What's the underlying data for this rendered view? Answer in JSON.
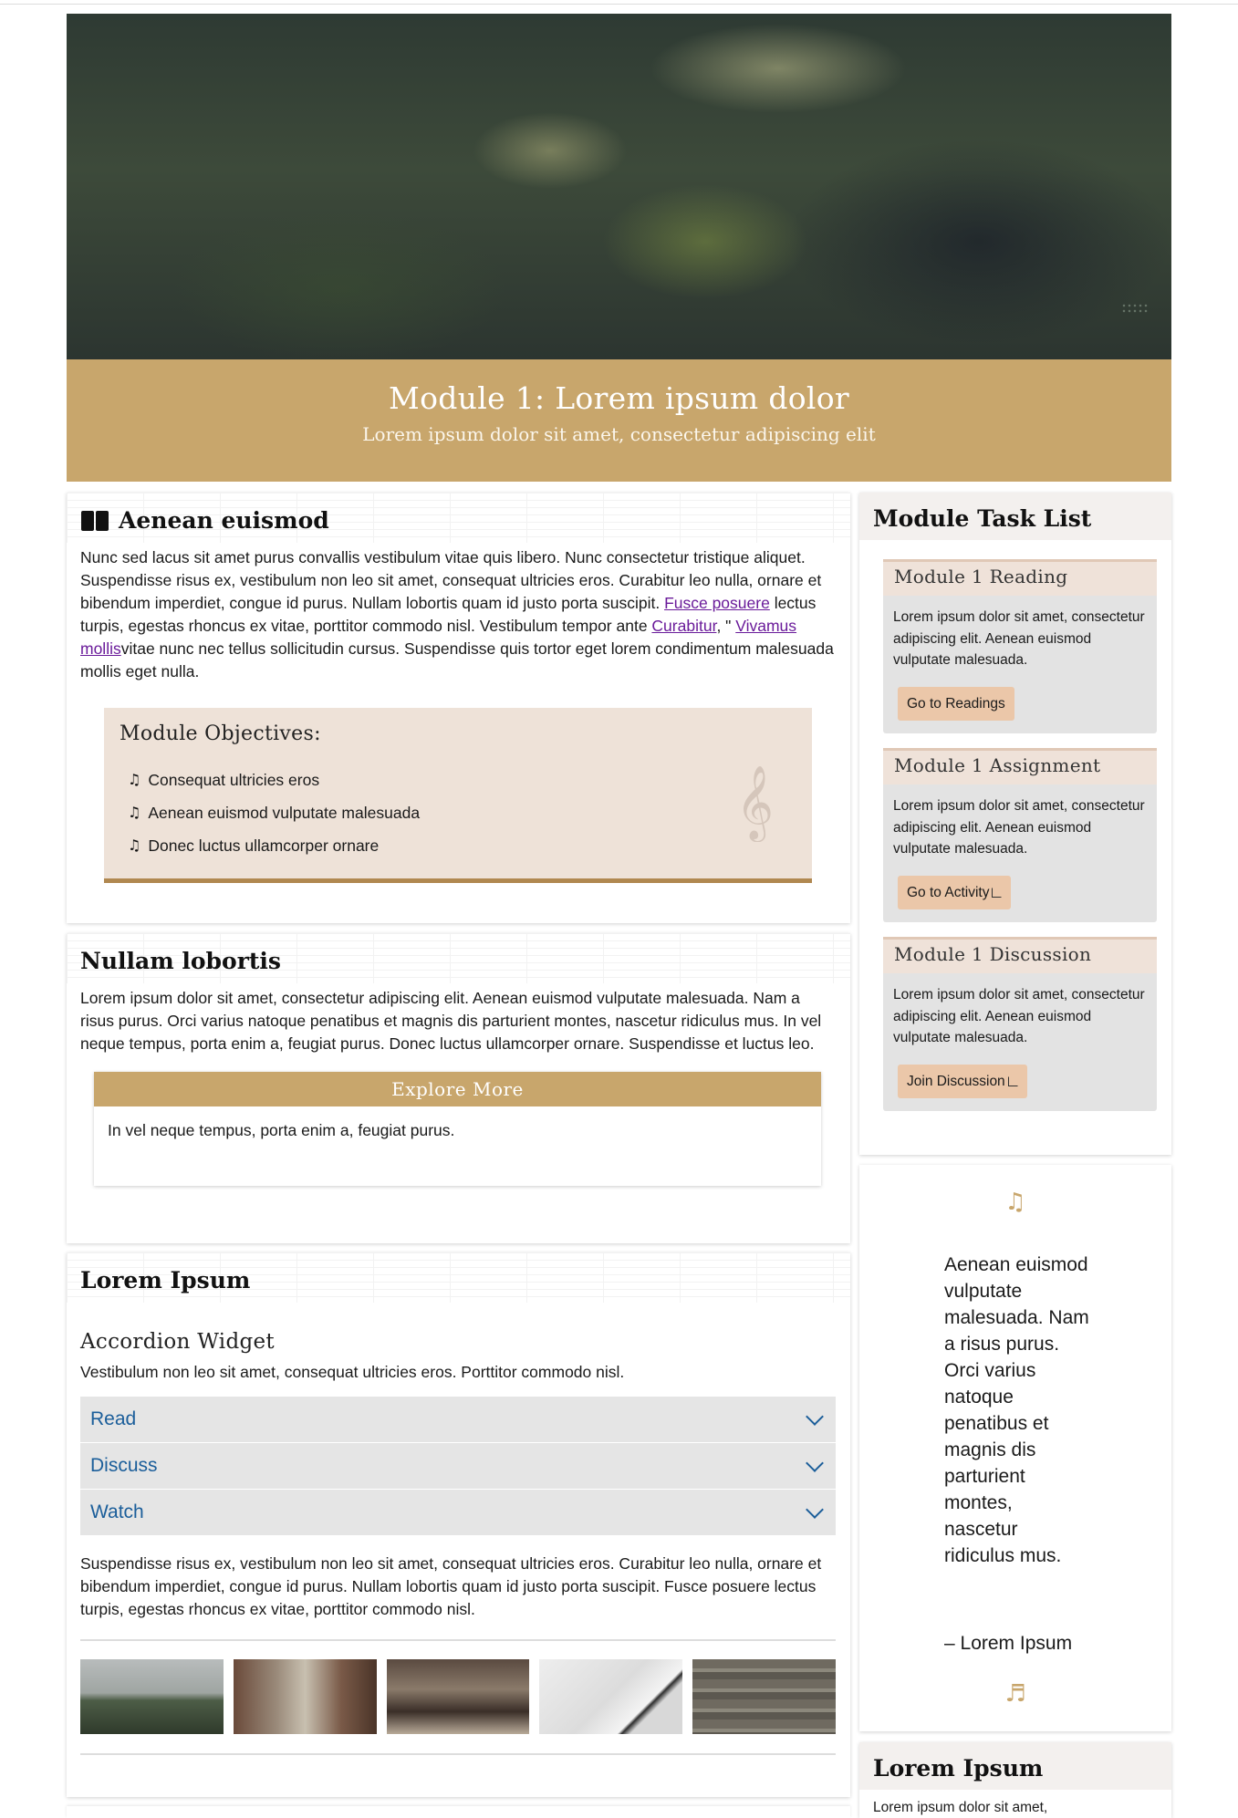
{
  "header": {
    "title": "Module 1: Lorem ipsum dolor",
    "subtitle": "Lorem ipsum dolor sit amet, consectetur adipiscing elit"
  },
  "section1": {
    "heading": "Aenean euismod",
    "p_part1": "Nunc sed lacus sit amet purus convallis vestibulum vitae quis libero. Nunc consectetur tristique aliquet. Suspendisse risus ex, vestibulum non leo sit amet, consequat ultricies eros. Curabitur leo nulla, ornare et bibendum imperdiet, congue id purus. Nullam lobortis quam id justo porta suscipit. ",
    "link1": "Fusce posuere",
    "p_part2": " lectus turpis, egestas rhoncus ex vitae, porttitor commodo nisl. Vestibulum tempor ante ",
    "link2": "Curabitur",
    "p_part3": ", \" ",
    "link3": "Vivamus mollis",
    "p_part4": "vitae nunc nec tellus sollicitudin cursus. Suspendisse quis tortor eget lorem condimentum malesuada mollis eget nulla.",
    "objectives": {
      "title": "Module Objectives:",
      "items": [
        "Consequat ultricies eros",
        "Aenean euismod vulputate malesuada",
        "Donec luctus ullamcorper ornare"
      ]
    }
  },
  "section2": {
    "heading": "Nullam lobortis",
    "text": "Lorem ipsum dolor sit amet, consectetur adipiscing elit. Aenean euismod vulputate malesuada. Nam a risus purus. Orci varius natoque penatibus et magnis dis parturient montes, nascetur ridiculus mus. In vel neque tempus, porta enim a, feugiat purus. Donec luctus ullamcorper ornare. Suspendisse et luctus leo.",
    "explore_title": "Explore More",
    "explore_text": "In vel neque tempus, porta enim a, feugiat purus."
  },
  "section3": {
    "heading": "Lorem Ipsum",
    "accordion_title": "Accordion Widget",
    "lead": "Vestibulum non leo sit amet, consequat ultricies eros. Porttitor commodo nisl.",
    "accordion_items": [
      "Read",
      "Discuss",
      "Watch"
    ],
    "tail": "Suspendisse risus ex, vestibulum non leo sit amet, consequat ultricies eros. Curabitur leo nulla, ornare et bibendum imperdiet, congue id purus. Nullam lobortis quam id justo porta suscipit. Fusce posuere lectus turpis, egestas rhoncus ex vitae, porttitor commodo nisl."
  },
  "tasklist": {
    "title": "Module Task List",
    "tasks": [
      {
        "title": "Module 1 Reading",
        "text": "Lorem ipsum dolor sit amet, consectetur adipiscing elit. Aenean euismod vulputate malesuada.",
        "button": "Go to Readings"
      },
      {
        "title": "Module 1 Assignment",
        "text": "Lorem ipsum dolor sit amet, consectetur adipiscing elit. Aenean euismod vulputate malesuada.",
        "button": "Go to Activity"
      },
      {
        "title": "Module 1 Discussion",
        "text": "Lorem ipsum dolor sit amet, consectetur adipiscing elit. Aenean euismod vulputate malesuada.",
        "button": "Join Discussion"
      }
    ]
  },
  "quote": {
    "text": "Aenean euismod vulputate malesuada. Nam a risus purus. Orci varius natoque penatibus et magnis dis parturient montes, nascetur ridiculus mus.",
    "cite": "– Lorem Ipsum",
    "top_icon": "music-note-icon",
    "bottom_icon": "music-notes-icon"
  },
  "side3": {
    "heading": "Lorem Ipsum",
    "peek": "Lorem ipsum dolor sit amet,"
  },
  "colors": {
    "accent_gold": "#c8a66c",
    "objectives_bg": "#eee2d8",
    "button_bg": "#ebc7a9",
    "accordion_text": "#1b5e9a",
    "link": "#6a1b9a"
  }
}
